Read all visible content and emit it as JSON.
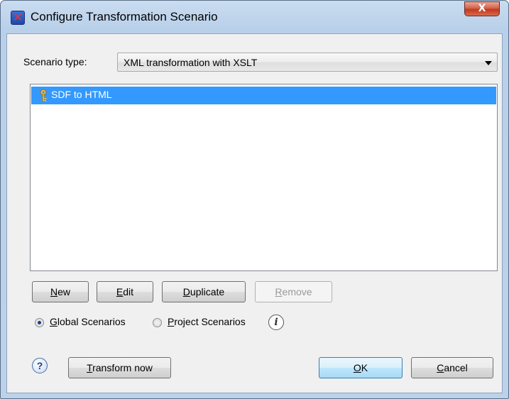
{
  "window": {
    "title": "Configure Transformation Scenario",
    "close_glyph": "X"
  },
  "scenario_type": {
    "label": "Scenario type:",
    "selected": "XML transformation with XSLT"
  },
  "scenarios": [
    {
      "label": "SDF to HTML",
      "icon": "key-icon",
      "selected": true
    }
  ],
  "buttons": {
    "new": {
      "mnemonic": "N",
      "rest": "ew"
    },
    "edit": {
      "mnemonic": "E",
      "rest": "dit"
    },
    "duplicate": {
      "mnemonic": "D",
      "rest": "uplicate"
    },
    "remove": {
      "mnemonic": "R",
      "rest": "emove",
      "enabled": false
    }
  },
  "scope": {
    "global": {
      "mnemonic": "G",
      "rest": "lobal Scenarios",
      "checked": true
    },
    "project": {
      "mnemonic": "P",
      "rest": "roject Scenarios",
      "checked": false
    },
    "info_glyph": "i"
  },
  "footer": {
    "help_glyph": "?",
    "transform": {
      "mnemonic": "T",
      "rest": "ransform now"
    },
    "ok": {
      "mnemonic": "O",
      "rest": "K"
    },
    "cancel": {
      "mnemonic": "C",
      "rest": "ancel"
    }
  },
  "colors": {
    "selection": "#3399ff",
    "close_button": "#c0391f"
  }
}
